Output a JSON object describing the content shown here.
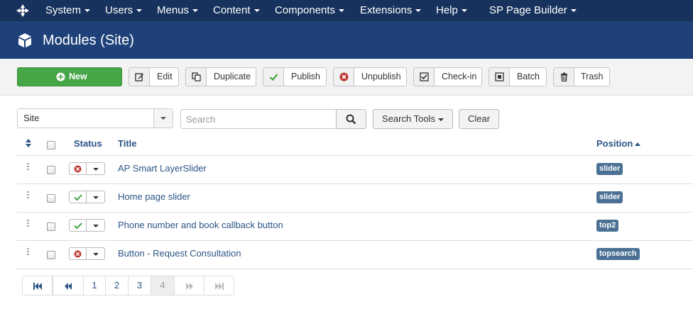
{
  "nav": {
    "items": [
      {
        "label": "System"
      },
      {
        "label": "Users"
      },
      {
        "label": "Menus"
      },
      {
        "label": "Content"
      },
      {
        "label": "Components"
      },
      {
        "label": "Extensions"
      },
      {
        "label": "Help"
      },
      {
        "label": "SP Page Builder"
      }
    ]
  },
  "header": {
    "title": "Modules (Site)",
    "icon": "cube-icon"
  },
  "toolbar": {
    "new": "New",
    "edit": "Edit",
    "duplicate": "Duplicate",
    "publish": "Publish",
    "unpublish": "Unpublish",
    "checkin": "Check-in",
    "batch": "Batch",
    "trash": "Trash"
  },
  "filters": {
    "client_select": "Site",
    "search_placeholder": "Search",
    "search_tools": "Search Tools",
    "clear": "Clear"
  },
  "table": {
    "headers": {
      "status": "Status",
      "title": "Title",
      "position": "Position"
    },
    "rows": [
      {
        "title": "AP Smart LayerSlider",
        "status": "unpublished",
        "position": "slider"
      },
      {
        "title": "Home page slider",
        "status": "published",
        "position": "slider"
      },
      {
        "title": "Phone number and book callback button",
        "status": "published",
        "position": "top2"
      },
      {
        "title": "Button - Request Consultation",
        "status": "unpublished",
        "position": "topsearch"
      }
    ]
  },
  "pagination": {
    "pages": [
      "1",
      "2",
      "3",
      "4"
    ],
    "current": "4"
  },
  "colors": {
    "navbar": "#17325c",
    "header": "#1f4179",
    "new_button": "#46a546",
    "published": "#46a546",
    "unpublished": "#bd362f",
    "badge": "#4a7194"
  }
}
